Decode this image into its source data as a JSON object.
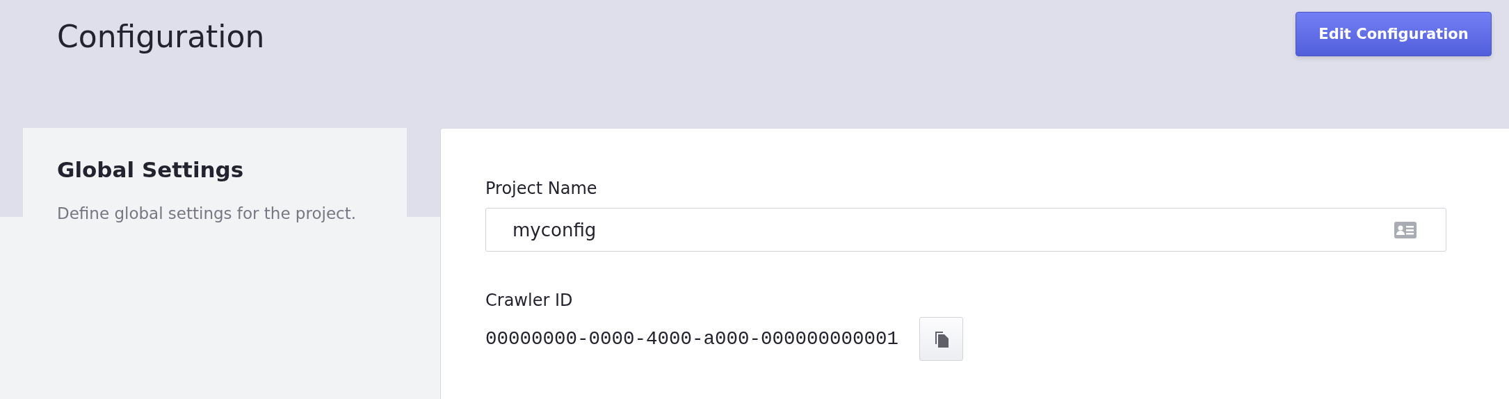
{
  "header": {
    "title": "Configuration",
    "edit_button": "Edit Configuration"
  },
  "sidebar": {
    "title": "Global Settings",
    "description": "Define global settings for the project."
  },
  "fields": [
    {
      "kind": "input",
      "label": "Project Name",
      "value": "myconfig"
    },
    {
      "kind": "copy",
      "label": "Crawler ID",
      "value": "00000000-0000-4000-a000-000000000001"
    }
  ]
}
